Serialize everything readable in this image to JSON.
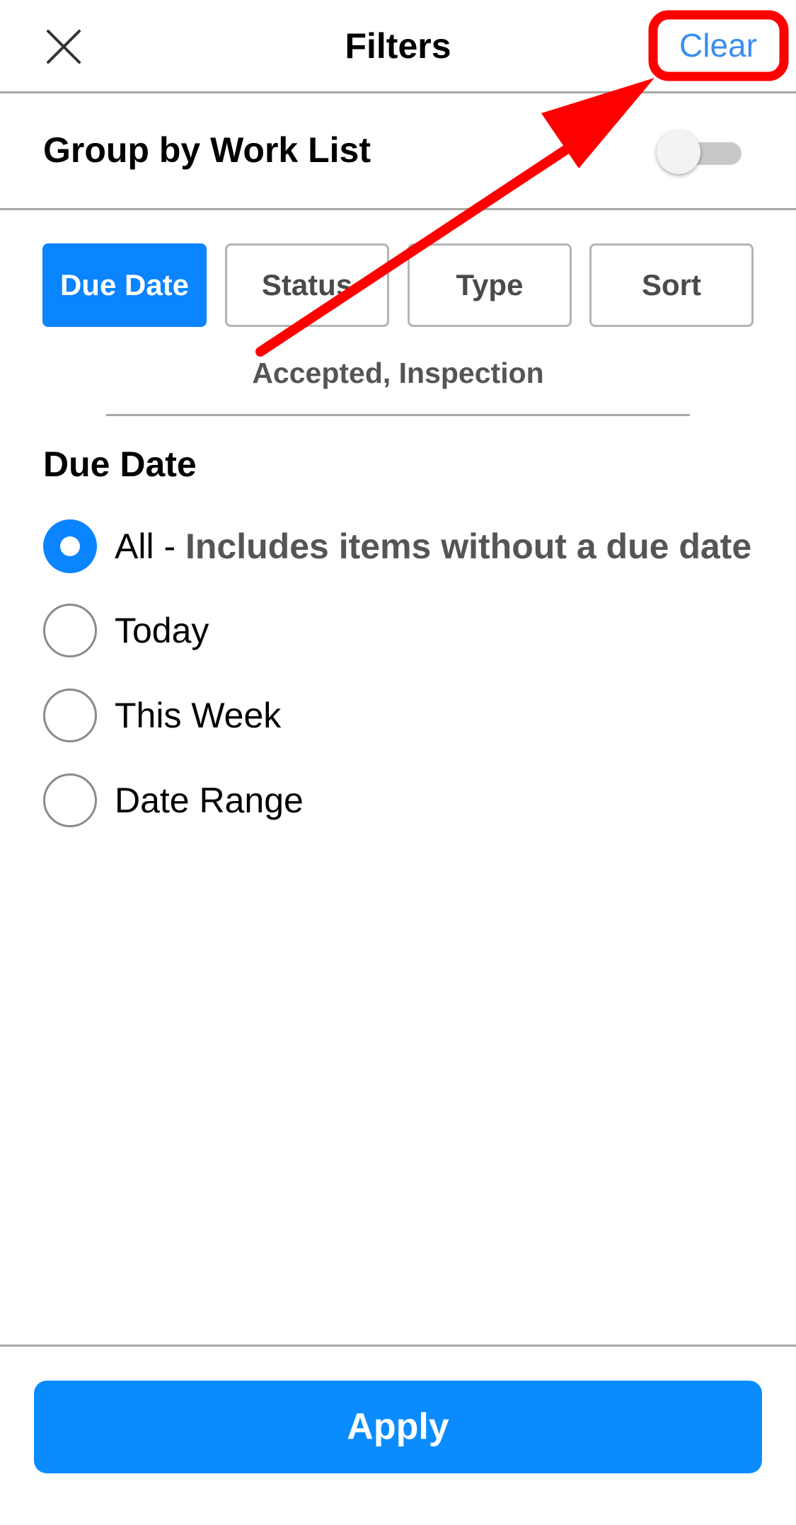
{
  "header": {
    "title": "Filters",
    "clear_label": "Clear"
  },
  "group_by": {
    "label": "Group by Work List",
    "enabled": false
  },
  "tabs": [
    {
      "label": "Due Date",
      "active": true
    },
    {
      "label": "Status",
      "active": false
    },
    {
      "label": "Type",
      "active": false
    },
    {
      "label": "Sort",
      "active": false
    }
  ],
  "summary": "Accepted, Inspection",
  "due_date": {
    "section_title": "Due Date",
    "options": [
      {
        "label": "All - ",
        "description": "Includes items without a due date",
        "selected": true
      },
      {
        "label": "Today",
        "description": "",
        "selected": false
      },
      {
        "label": "This Week",
        "description": "",
        "selected": false
      },
      {
        "label": "Date Range",
        "description": "",
        "selected": false
      }
    ]
  },
  "footer": {
    "apply_label": "Apply"
  },
  "colors": {
    "accent": "#0a84ff",
    "link": "#3a8ef0",
    "annotation": "#ff0000"
  },
  "icons": {
    "close": "close-icon",
    "radio_checked": "radio-checked-icon",
    "radio_unchecked": "radio-unchecked-icon"
  }
}
